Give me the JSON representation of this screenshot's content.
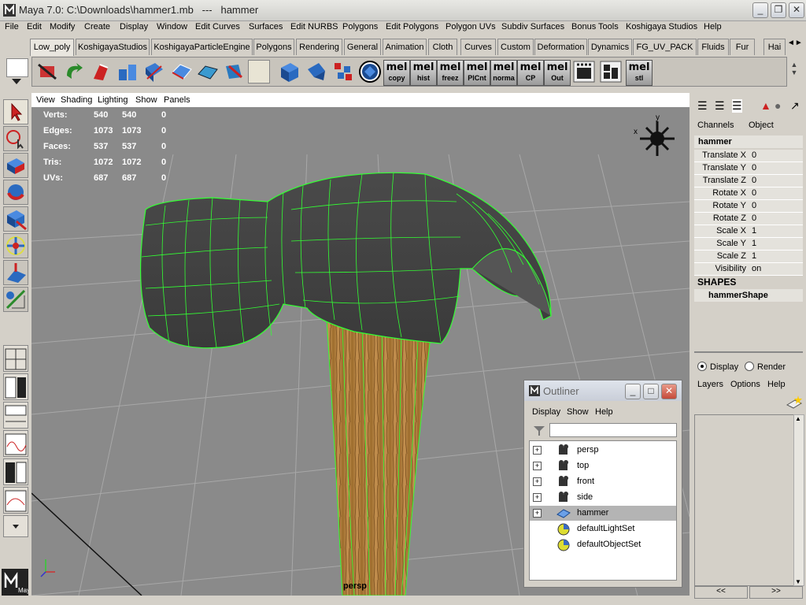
{
  "window": {
    "title": "Maya 7.0: C:\\Downloads\\hammer1.mb   ---   hammer",
    "buttons": [
      "_",
      "❐",
      "✕"
    ]
  },
  "menu": [
    "File",
    "Edit",
    "Modify",
    "Create",
    "Display",
    "Window",
    "Edit Curves",
    "Surfaces",
    "Edit NURBS",
    "Polygons",
    "Edit Polygons",
    "Polygon UVs",
    "Subdiv Surfaces",
    "Bonus Tools",
    "Koshigaya Studios",
    "Help"
  ],
  "shelf_tabs": [
    "Low_poly",
    "KoshigayaStudios",
    "KoshigayaParticleEngine",
    "Polygons",
    "Rendering",
    "General",
    "Animation",
    "Cloth",
    "Curves",
    "Custom",
    "Deformation",
    "Dynamics",
    "FG_UV_PACK",
    "Fluids",
    "Fur",
    "Hai"
  ],
  "shelf_mel": [
    {
      "top": "mel",
      "label": "copy"
    },
    {
      "top": "mel",
      "label": "hist"
    },
    {
      "top": "mel",
      "label": "freez"
    },
    {
      "top": "mel",
      "label": "PlCnt"
    },
    {
      "top": "mel",
      "label": "norma"
    },
    {
      "top": "mel",
      "label": "CP"
    },
    {
      "top": "mel",
      "label": "Out"
    },
    {
      "top": "mel",
      "label": "stl"
    }
  ],
  "viewport": {
    "menu": [
      "View",
      "Shading",
      "Lighting",
      "Show",
      "Panels"
    ],
    "camera_label": "persp",
    "axis_y": "y",
    "axis_x": "x",
    "hud": [
      {
        "label": "Verts:",
        "a": "540",
        "b": "540",
        "c": "0"
      },
      {
        "label": "Edges:",
        "a": "1073",
        "b": "1073",
        "c": "0"
      },
      {
        "label": "Faces:",
        "a": "537",
        "b": "537",
        "c": "0"
      },
      {
        "label": "Tris:",
        "a": "1072",
        "b": "1072",
        "c": "0"
      },
      {
        "label": "UVs:",
        "a": "687",
        "b": "687",
        "c": "0"
      }
    ]
  },
  "channel_box": {
    "tabs": [
      "Channels",
      "Object"
    ],
    "object": "hammer",
    "attrs": [
      {
        "name": "Translate X",
        "value": "0"
      },
      {
        "name": "Translate Y",
        "value": "0"
      },
      {
        "name": "Translate Z",
        "value": "0"
      },
      {
        "name": "Rotate X",
        "value": "0"
      },
      {
        "name": "Rotate Y",
        "value": "0"
      },
      {
        "name": "Rotate Z",
        "value": "0"
      },
      {
        "name": "Scale X",
        "value": "1"
      },
      {
        "name": "Scale Y",
        "value": "1"
      },
      {
        "name": "Scale Z",
        "value": "1"
      },
      {
        "name": "Visibility",
        "value": "on"
      }
    ],
    "shapes_header": "SHAPES",
    "shape": "hammerShape"
  },
  "layer_editor": {
    "display_label": "Display",
    "render_label": "Render",
    "menu": [
      "Layers",
      "Options",
      "Help"
    ],
    "nav_left": "<<",
    "nav_right": ">>"
  },
  "outliner": {
    "title": "Outliner",
    "menu": [
      "Display",
      "Show",
      "Help"
    ],
    "items": [
      "persp",
      "top",
      "front",
      "side",
      "hammer",
      "defaultLightSet",
      "defaultObjectSet"
    ],
    "selected": "hammer"
  },
  "logo": "Maya"
}
